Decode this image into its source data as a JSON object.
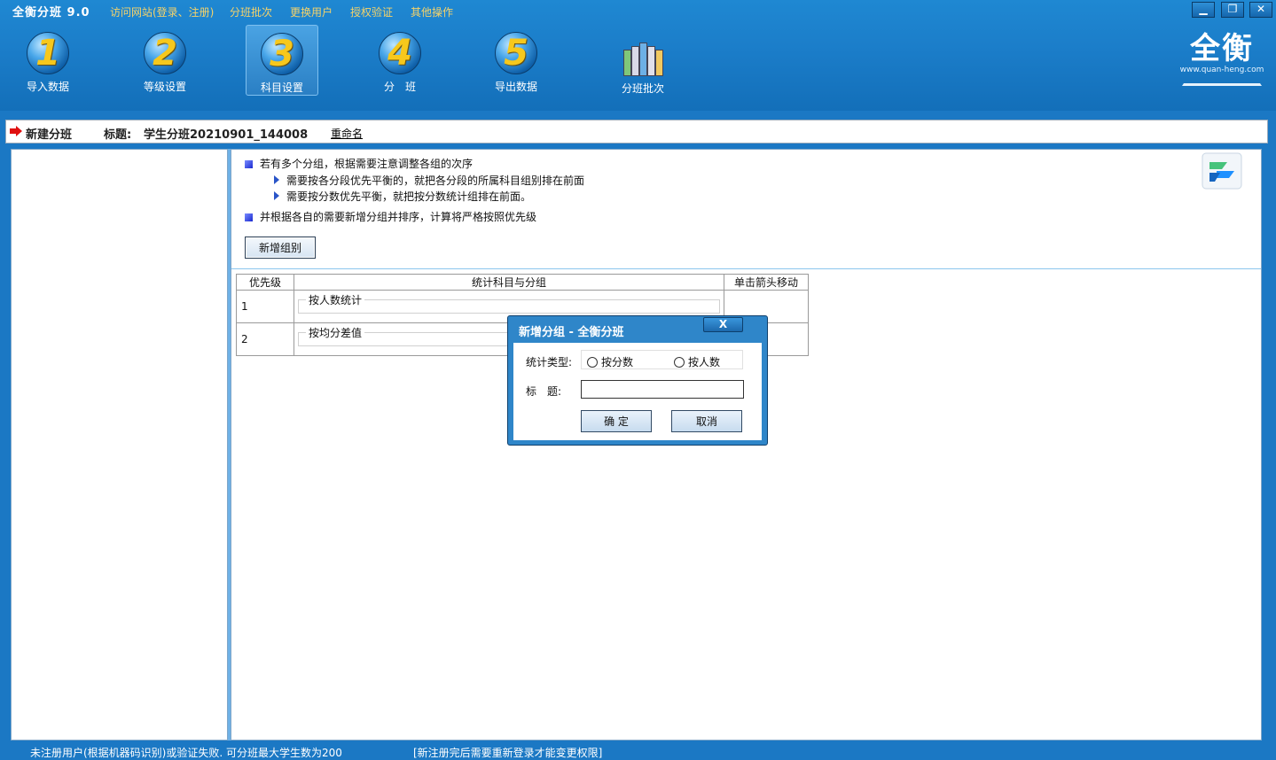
{
  "app": {
    "title": "全衡分班 9.0",
    "menu": [
      "访问网站(登录、注册)",
      "分班批次",
      "更换用户",
      "授权验证",
      "其他操作"
    ],
    "window_controls": [
      "minimize",
      "restore",
      "close"
    ]
  },
  "toolbar": {
    "items": [
      {
        "number": "1",
        "label": "导入数据"
      },
      {
        "number": "2",
        "label": "等级设置"
      },
      {
        "number": "3",
        "label": "科目设置",
        "active": true
      },
      {
        "number": "4",
        "label": "分　班"
      },
      {
        "number": "5",
        "label": "导出数据"
      },
      {
        "icon": "books-icon",
        "label": "分班批次"
      }
    ]
  },
  "logo": {
    "text": "全衡",
    "url": "www.quan-heng.com"
  },
  "header": {
    "title": "新建分班",
    "label": "标题:",
    "value": "学生分班20210901_144008",
    "rename": "重命名"
  },
  "tips": {
    "line1": "若有多个分组，根据需要注意调整各组的次序",
    "line2": "需要按各分段优先平衡的，就把各分段的所属科目组别排在前面",
    "line3": "需要按分数优先平衡，就把按分数统计组排在前面。",
    "line4": "并根据各自的需要新增分组并排序，计算将严格按照优先级"
  },
  "add_group_button": "新增组别",
  "table": {
    "headers": [
      "优先级",
      "统计科目与分组",
      "单击箭头移动"
    ],
    "rows": [
      {
        "priority": "1",
        "group": "按人数统计"
      },
      {
        "priority": "2",
        "group": "按均分差值"
      }
    ]
  },
  "dialog": {
    "title": "新增分组 - 全衡分班",
    "close": "X",
    "type_label": "统计类型:",
    "options": [
      "按分数",
      "按人数"
    ],
    "title_label": "标　题:",
    "title_value": "",
    "ok": "确 定",
    "cancel": "取消"
  },
  "status": {
    "left": "未注册用户(根据机器码识别)或验证失败. 可分班最大学生数为200",
    "right": "[新注册完后需要重新登录才能变更权限]"
  },
  "colors": {
    "background": "#1b78c4",
    "menu_text": "#f5d36a",
    "number_gold": "#f7c81c"
  }
}
